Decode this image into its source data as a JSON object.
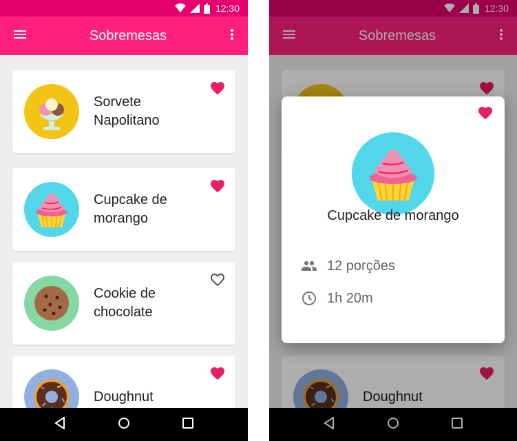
{
  "colors": {
    "accent": "#ff1f7d",
    "accent_dark": "#e5006e",
    "heart": "#e91e63"
  },
  "status_bar": {
    "time": "12:30"
  },
  "app_bar": {
    "title": "Sobremesas",
    "menu_icon": "menu-icon",
    "more_icon": "more-vert-icon"
  },
  "list": [
    {
      "name": "Sorvete Napolitano",
      "favorite": true,
      "icon": "ice-cream-icon"
    },
    {
      "name": "Cupcake de morango",
      "favorite": true,
      "icon": "cupcake-icon"
    },
    {
      "name": "Cookie de chocolate",
      "favorite": false,
      "icon": "cookie-icon"
    },
    {
      "name": "Doughnut",
      "favorite": true,
      "icon": "doughnut-icon"
    }
  ],
  "detail": {
    "name": "Cupcake de morango",
    "favorite": true,
    "servings": "12 porções",
    "time": "1h 20m"
  },
  "nav_bar": {
    "back": "back-icon",
    "home": "home-icon",
    "recents": "recents-icon"
  }
}
